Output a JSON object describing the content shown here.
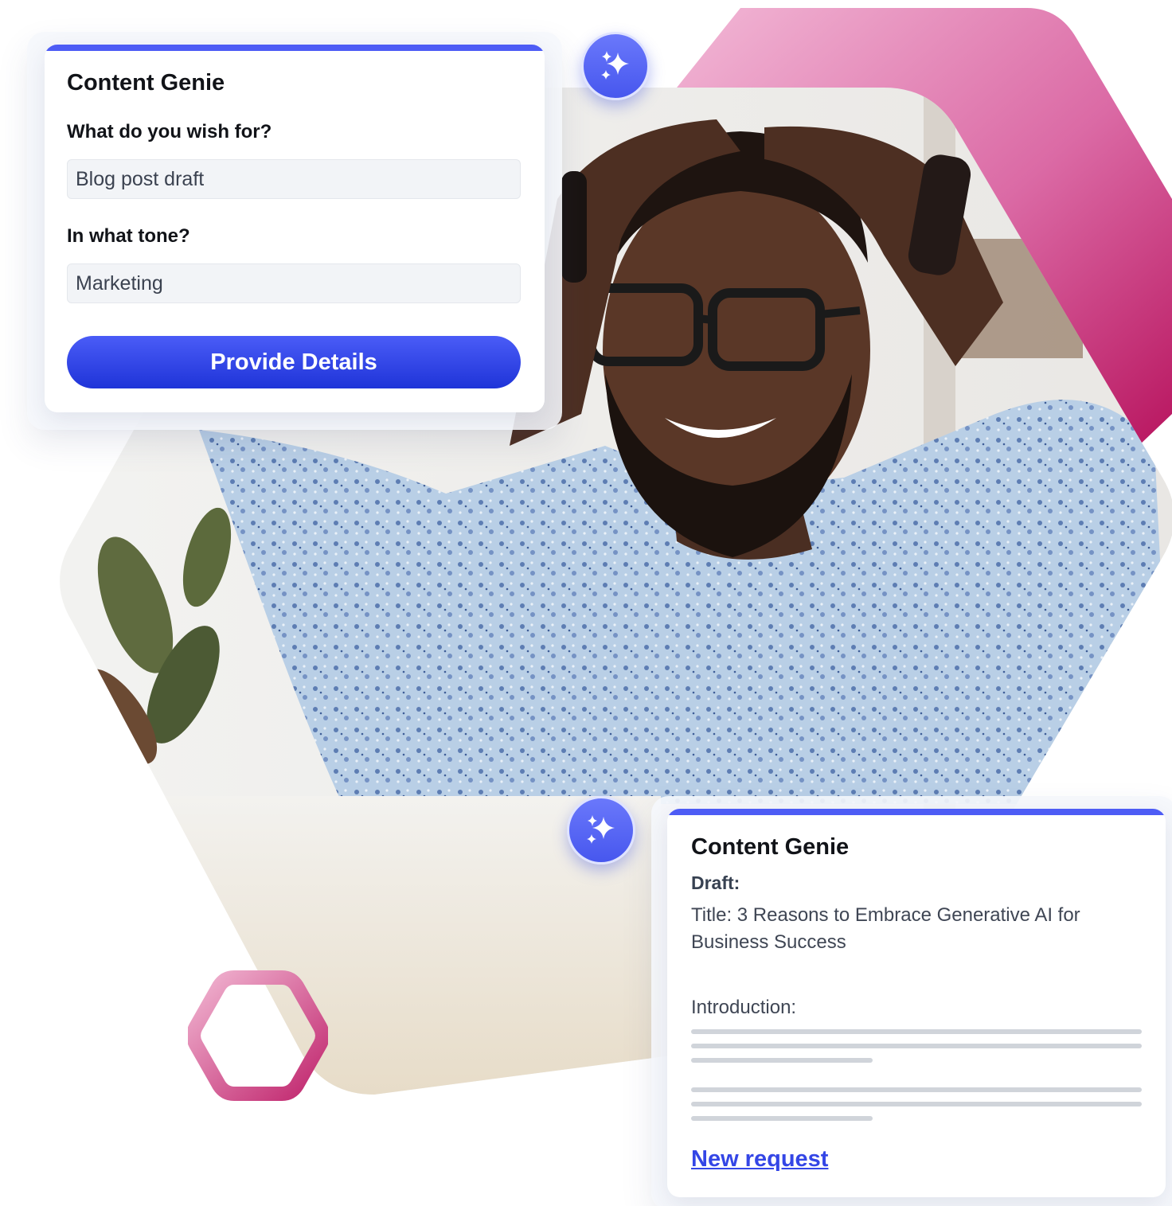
{
  "form_card": {
    "title": "Content Genie",
    "wish_label": "What do you wish for?",
    "wish_value": "Blog post draft",
    "tone_label": "In what tone?",
    "tone_value": "Marketing",
    "submit_label": "Provide Details"
  },
  "result_card": {
    "title": "Content Genie",
    "draft_label": "Draft:",
    "draft_title": "Title: 3 Reasons to Embrace Generative AI for Business Success",
    "intro_label": "Introduction:",
    "new_request_label": "New request"
  },
  "colors": {
    "accent_blue": "#4a5cf7",
    "brand_pink": "#c2185b",
    "card_top_bar": "#4d5cf5"
  },
  "icons": {
    "badge": "sparkle-icon"
  }
}
